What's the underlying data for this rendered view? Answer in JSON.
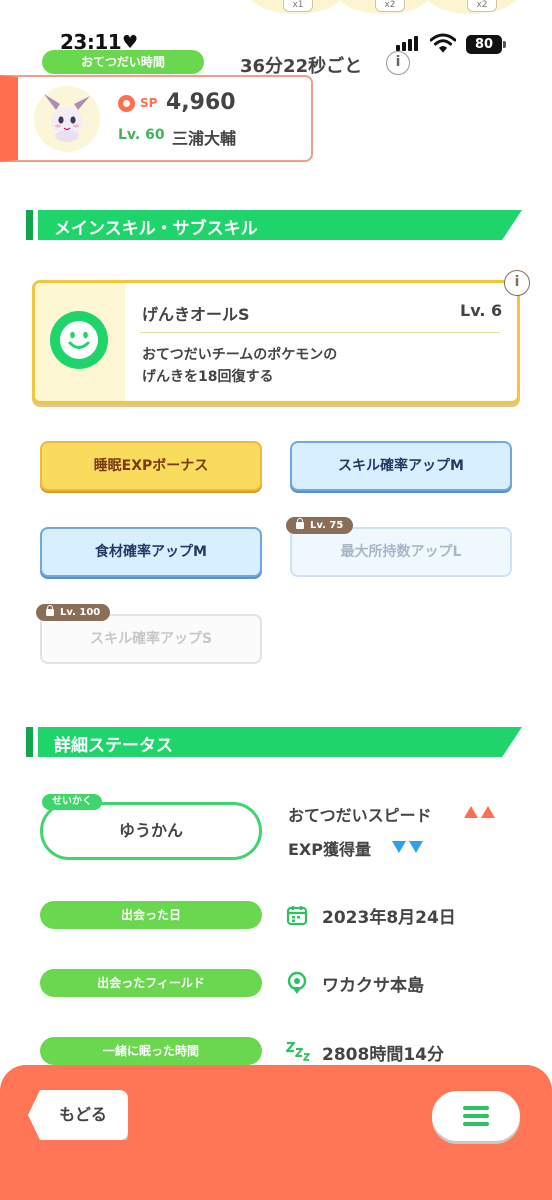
{
  "top_badges": [
    "x1",
    "x2",
    "x2"
  ],
  "status_bar": {
    "time": "23:11",
    "heart": "♥",
    "battery": "80"
  },
  "helper": {
    "label": "おてつだい時間",
    "interval": "36分22秒ごと",
    "info_glyph": "i"
  },
  "pokemon": {
    "sp_label": "SP",
    "sp_value": "4,960",
    "level": "Lv. 60",
    "trainer_name": "三浦大輔"
  },
  "skills_section": {
    "title": "メインスキル・サブスキル"
  },
  "main_skill": {
    "name": "げんきオールS",
    "level": "Lv. 6",
    "desc_line1": "おてつだいチームのポケモンの",
    "desc_line2": "げんきを18回復する",
    "info_glyph": "i"
  },
  "sub_skills": [
    {
      "label": "睡眠EXPボーナス",
      "lock": ""
    },
    {
      "label": "スキル確率アップM",
      "lock": ""
    },
    {
      "label": "食材確率アップM",
      "lock": ""
    },
    {
      "label": "最大所持数アップL",
      "lock": "Lv. 75"
    },
    {
      "label": "スキル確率アップS",
      "lock": "Lv. 100"
    }
  ],
  "status_section": {
    "title": "詳細ステータス"
  },
  "nature": {
    "tag": "せいかく",
    "value": "ゆうかん",
    "up_label": "おてつだいスピード",
    "down_label": "EXP獲得量",
    "up_color": "#ff6f4e",
    "down_color": "#2c9ff0"
  },
  "details": {
    "met_date_label": "出会った日",
    "met_date_value": "2023年8月24日",
    "field_label": "出会ったフィールド",
    "field_value": "ワカクサ本島",
    "sleep_label": "一緒に眠った時間",
    "sleep_value": "2808時間14分"
  },
  "bottom": {
    "back_label": "もどる"
  },
  "colors": {
    "accent_green": "#1fd56b",
    "pill_green": "#6ad84f",
    "bottom_orange": "#ff7555"
  }
}
